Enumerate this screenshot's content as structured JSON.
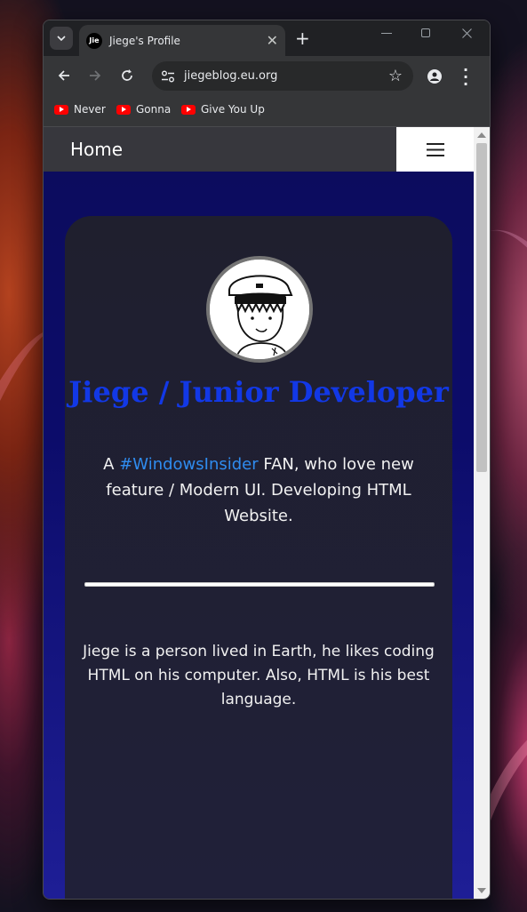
{
  "browser": {
    "tab_title": "Jiege's Profile",
    "favicon_text": "Jie",
    "url": "jiegeblog.eu.org",
    "bookmarks": [
      {
        "label": "Never",
        "icon": "youtube-icon"
      },
      {
        "label": "Gonna",
        "icon": "youtube-icon"
      },
      {
        "label": "Give You Up",
        "icon": "youtube-icon"
      }
    ]
  },
  "site": {
    "nav_home": "Home",
    "title": "Jiege / Junior Developer",
    "bio_prefix": "A ",
    "bio_hashtag": "#WindowsInsider",
    "bio_suffix": " FAN, who love new feature / Modern UI. Developing HTML Website.",
    "about": "Jiege is a person lived in Earth, he likes coding HTML on his computer. Also, HTML is his best language."
  },
  "colors": {
    "title": "#1238e6",
    "hashtag": "#2f8cef",
    "page_bg": "#0c0c6a",
    "card_bg": "#1f1f2e",
    "nav_bg": "#37373d"
  }
}
